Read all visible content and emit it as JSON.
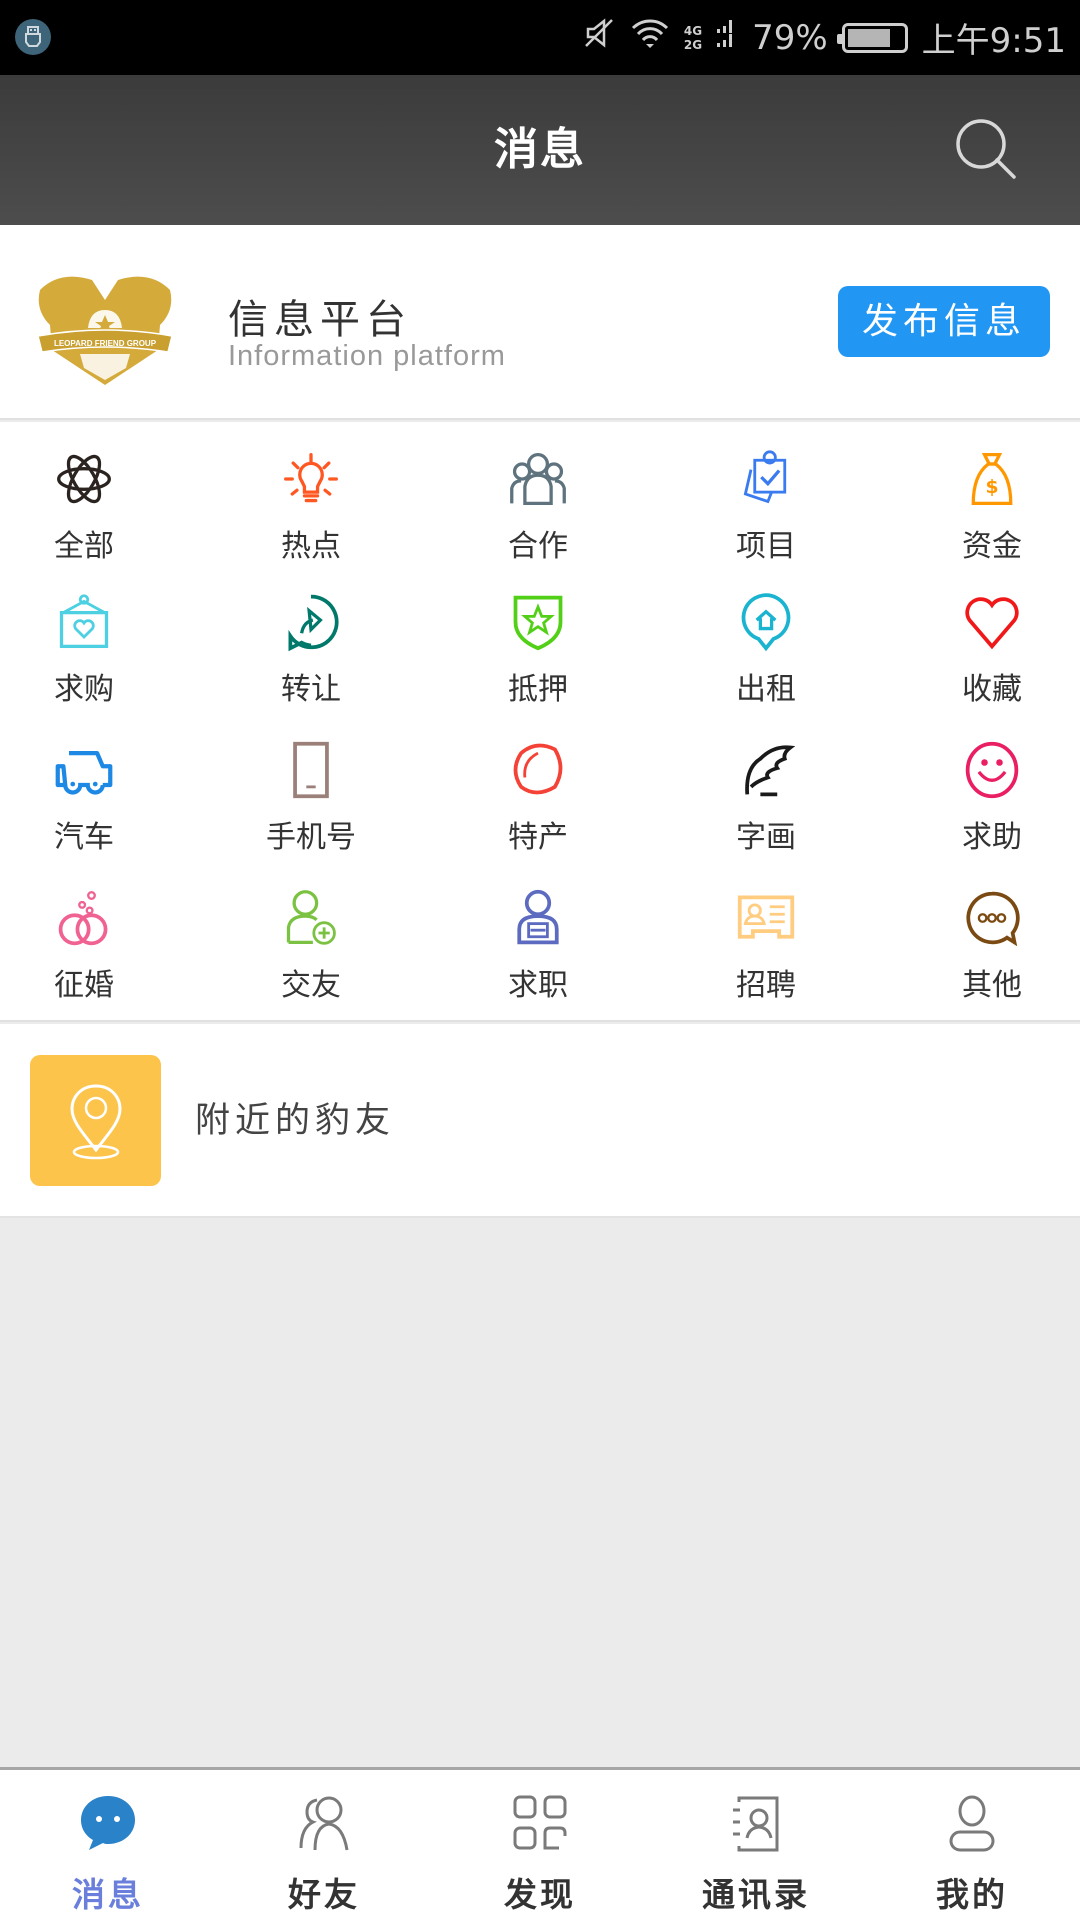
{
  "status_bar": {
    "battery_percent": "79%",
    "battery_level": 0.79,
    "network_top": "4G",
    "network_bottom": "2G",
    "time": "上午9:51",
    "icons": [
      "usb-icon",
      "mute-icon",
      "wifi-icon",
      "signal-icon",
      "battery-icon"
    ]
  },
  "header": {
    "title": "消息",
    "search_icon": "search-icon"
  },
  "platform": {
    "logo_text": "LEOPARD FRIEND GROUP",
    "title": "信息平台",
    "subtitle": "Information  platform",
    "publish_button": "发布信息",
    "colors": {
      "publish_button": "#2196f3"
    }
  },
  "categories": [
    {
      "label": "全部",
      "icon": "atom-icon",
      "color": "#2b2320"
    },
    {
      "label": "热点",
      "icon": "lightbulb-icon",
      "color": "#ff5722"
    },
    {
      "label": "合作",
      "icon": "group-icon",
      "color": "#5f737e"
    },
    {
      "label": "项目",
      "icon": "clipboard-check-icon",
      "color": "#3b7bf0"
    },
    {
      "label": "资金",
      "icon": "money-bag-icon",
      "color": "#ff9800"
    },
    {
      "label": "求购",
      "icon": "hanging-frame-heart-icon",
      "color": "#4dd0e1"
    },
    {
      "label": "转让",
      "icon": "share-bubble-icon",
      "color": "#00796b"
    },
    {
      "label": "抵押",
      "icon": "shield-star-icon",
      "color": "#52d017"
    },
    {
      "label": "出租",
      "icon": "home-pin-icon",
      "color": "#1ab4d0"
    },
    {
      "label": "收藏",
      "icon": "heart-icon",
      "color": "#f01818"
    },
    {
      "label": "汽车",
      "icon": "car-icon",
      "color": "#1e88e5"
    },
    {
      "label": "手机号",
      "icon": "phone-icon",
      "color": "#9a8078"
    },
    {
      "label": "特产",
      "icon": "lemon-icon",
      "color": "#f44336"
    },
    {
      "label": "字画",
      "icon": "feather-pen-icon",
      "color": "#1a1a1a"
    },
    {
      "label": "求助",
      "icon": "smile-icon",
      "color": "#e91e63"
    },
    {
      "label": "征婚",
      "icon": "rings-icon",
      "color": "#f06292"
    },
    {
      "label": "交友",
      "icon": "add-friend-icon",
      "color": "#7cc242"
    },
    {
      "label": "求职",
      "icon": "job-seeker-icon",
      "color": "#5c6bc0"
    },
    {
      "label": "招聘",
      "icon": "id-card-icon",
      "color": "#ffcc80"
    },
    {
      "label": "其他",
      "icon": "more-bubble-icon",
      "color": "#7b4a12"
    }
  ],
  "nearby": {
    "label": "附近的豹友",
    "icon": "location-pin-icon",
    "color": "#fcc44b"
  },
  "tabbar": {
    "active_index": 0,
    "active_color": "#2a82c9",
    "items": [
      {
        "label": "消息",
        "icon": "chat-bubble-icon"
      },
      {
        "label": "好友",
        "icon": "friends-icon"
      },
      {
        "label": "发现",
        "icon": "grid-icon"
      },
      {
        "label": "通讯录",
        "icon": "contacts-book-icon"
      },
      {
        "label": "我的",
        "icon": "person-icon"
      }
    ]
  }
}
